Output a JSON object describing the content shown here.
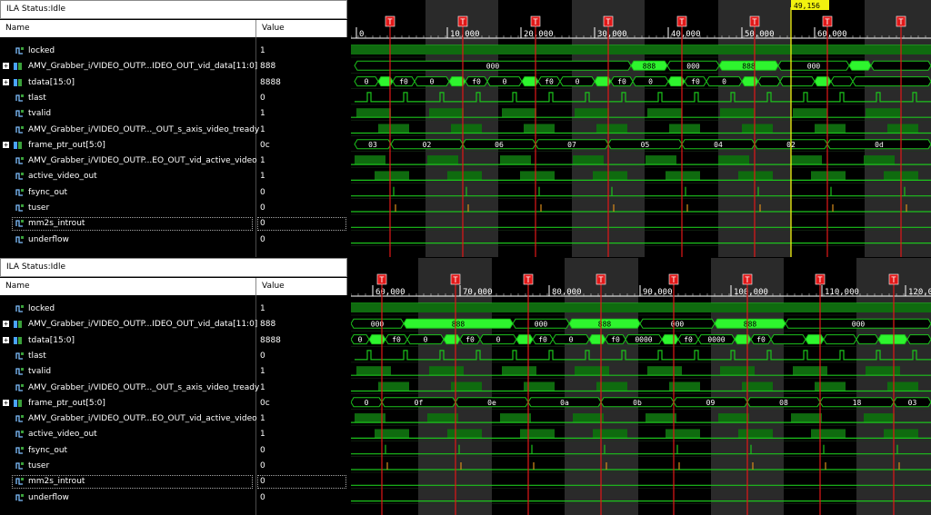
{
  "colors": {
    "signal": "#1cc31c",
    "bright": "#2ef52e",
    "trigger": "#e21818",
    "cursor": "#f2f20f",
    "stripe": "#2a2a2a"
  },
  "panels": [
    {
      "status": "ILA Status:Idle",
      "columns": {
        "name": "Name",
        "value": "Value"
      },
      "cursor": "49,156",
      "ticks": [
        "0",
        "10,000",
        "20,000",
        "30,000",
        "40,000",
        "50,000",
        "60,000"
      ],
      "trigger_marker": "T",
      "bus_labels": {
        "vid_data": [
          "000",
          "888",
          "000",
          "888",
          "000"
        ],
        "tdata": [
          "0",
          "f0",
          "0",
          "f0",
          "0",
          "f0",
          "0",
          "f0",
          "0",
          "f0",
          "0"
        ],
        "frame_ptr": [
          "03",
          "02",
          "06",
          "07",
          "05",
          "04",
          "02",
          "0d"
        ]
      },
      "signals": [
        {
          "name": "locked",
          "value": "1",
          "bus": false
        },
        {
          "name": "AMV_Grabber_i/VIDEO_OUTP...IDEO_OUT_vid_data[11:0]",
          "value": "888",
          "bus": true
        },
        {
          "name": "tdata[15:0]",
          "value": "8888",
          "bus": true
        },
        {
          "name": "tlast",
          "value": "0",
          "bus": false
        },
        {
          "name": "tvalid",
          "value": "1",
          "bus": false
        },
        {
          "name": "AMV_Grabber_i/VIDEO_OUTP..._OUT_s_axis_video_tready",
          "value": "1",
          "bus": false
        },
        {
          "name": "frame_ptr_out[5:0]",
          "value": "0c",
          "bus": true
        },
        {
          "name": "AMV_Grabber_i/VIDEO_OUTP...EO_OUT_vid_active_video",
          "value": "1",
          "bus": false
        },
        {
          "name": "active_video_out",
          "value": "1",
          "bus": false
        },
        {
          "name": "fsync_out",
          "value": "0",
          "bus": false
        },
        {
          "name": "tuser",
          "value": "0",
          "bus": false
        },
        {
          "name": "mm2s_introut",
          "value": "0",
          "bus": false,
          "selected": true
        },
        {
          "name": "underflow",
          "value": "0",
          "bus": false
        }
      ]
    },
    {
      "status": "ILA Status:Idle",
      "columns": {
        "name": "Name",
        "value": "Value"
      },
      "cursor": "",
      "ticks": [
        "60,000",
        "70,000",
        "80,000",
        "90,000",
        "100,000",
        "110,000",
        "120,0"
      ],
      "trigger_marker": "T",
      "bus_labels": {
        "vid_data": [
          "000",
          "888",
          "000",
          "888",
          "000",
          "888",
          "000"
        ],
        "tdata": [
          "0",
          "f0",
          "0",
          "f0",
          "0",
          "f0",
          "0",
          "f0",
          "0000",
          "f0",
          "0000",
          "f0"
        ],
        "frame_ptr": [
          "0",
          "0f",
          "0e",
          "0a",
          "0b",
          "09",
          "08",
          "18",
          "03"
        ]
      },
      "signals": [
        {
          "name": "locked",
          "value": "1",
          "bus": false
        },
        {
          "name": "AMV_Grabber_i/VIDEO_OUTP...IDEO_OUT_vid_data[11:0]",
          "value": "888",
          "bus": true
        },
        {
          "name": "tdata[15:0]",
          "value": "8888",
          "bus": true
        },
        {
          "name": "tlast",
          "value": "0",
          "bus": false
        },
        {
          "name": "tvalid",
          "value": "1",
          "bus": false
        },
        {
          "name": "AMV_Grabber_i/VIDEO_OUTP..._OUT_s_axis_video_tready",
          "value": "1",
          "bus": false
        },
        {
          "name": "frame_ptr_out[5:0]",
          "value": "0c",
          "bus": true
        },
        {
          "name": "AMV_Grabber_i/VIDEO_OUTP...EO_OUT_vid_active_video",
          "value": "1",
          "bus": false
        },
        {
          "name": "active_video_out",
          "value": "1",
          "bus": false
        },
        {
          "name": "fsync_out",
          "value": "0",
          "bus": false
        },
        {
          "name": "tuser",
          "value": "0",
          "bus": false
        },
        {
          "name": "mm2s_introut",
          "value": "0",
          "bus": false,
          "selected": true
        },
        {
          "name": "underflow",
          "value": "0",
          "bus": false
        }
      ]
    }
  ]
}
